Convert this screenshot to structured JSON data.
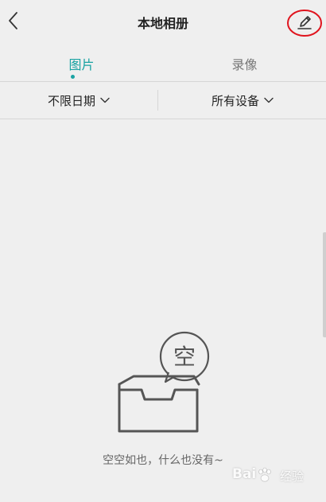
{
  "header": {
    "title": "本地相册",
    "back_icon": "chevron-left-icon",
    "edit_icon": "pencil-icon",
    "edit_highlight_color": "#e0141e"
  },
  "tabs": [
    {
      "label": "图片",
      "active": true
    },
    {
      "label": "录像",
      "active": false
    }
  ],
  "accent_color": "#1aa3a3",
  "filters": {
    "date": {
      "label": "不限日期",
      "icon": "chevron-down-icon"
    },
    "device": {
      "label": "所有设备",
      "icon": "chevron-down-icon"
    }
  },
  "empty_state": {
    "bubble_text": "空",
    "message": "空空如也，什么也没有~",
    "icon": "empty-box-icon"
  },
  "watermark": {
    "brand": "Bai",
    "brand_suffix": "du",
    "sub": "经验"
  }
}
